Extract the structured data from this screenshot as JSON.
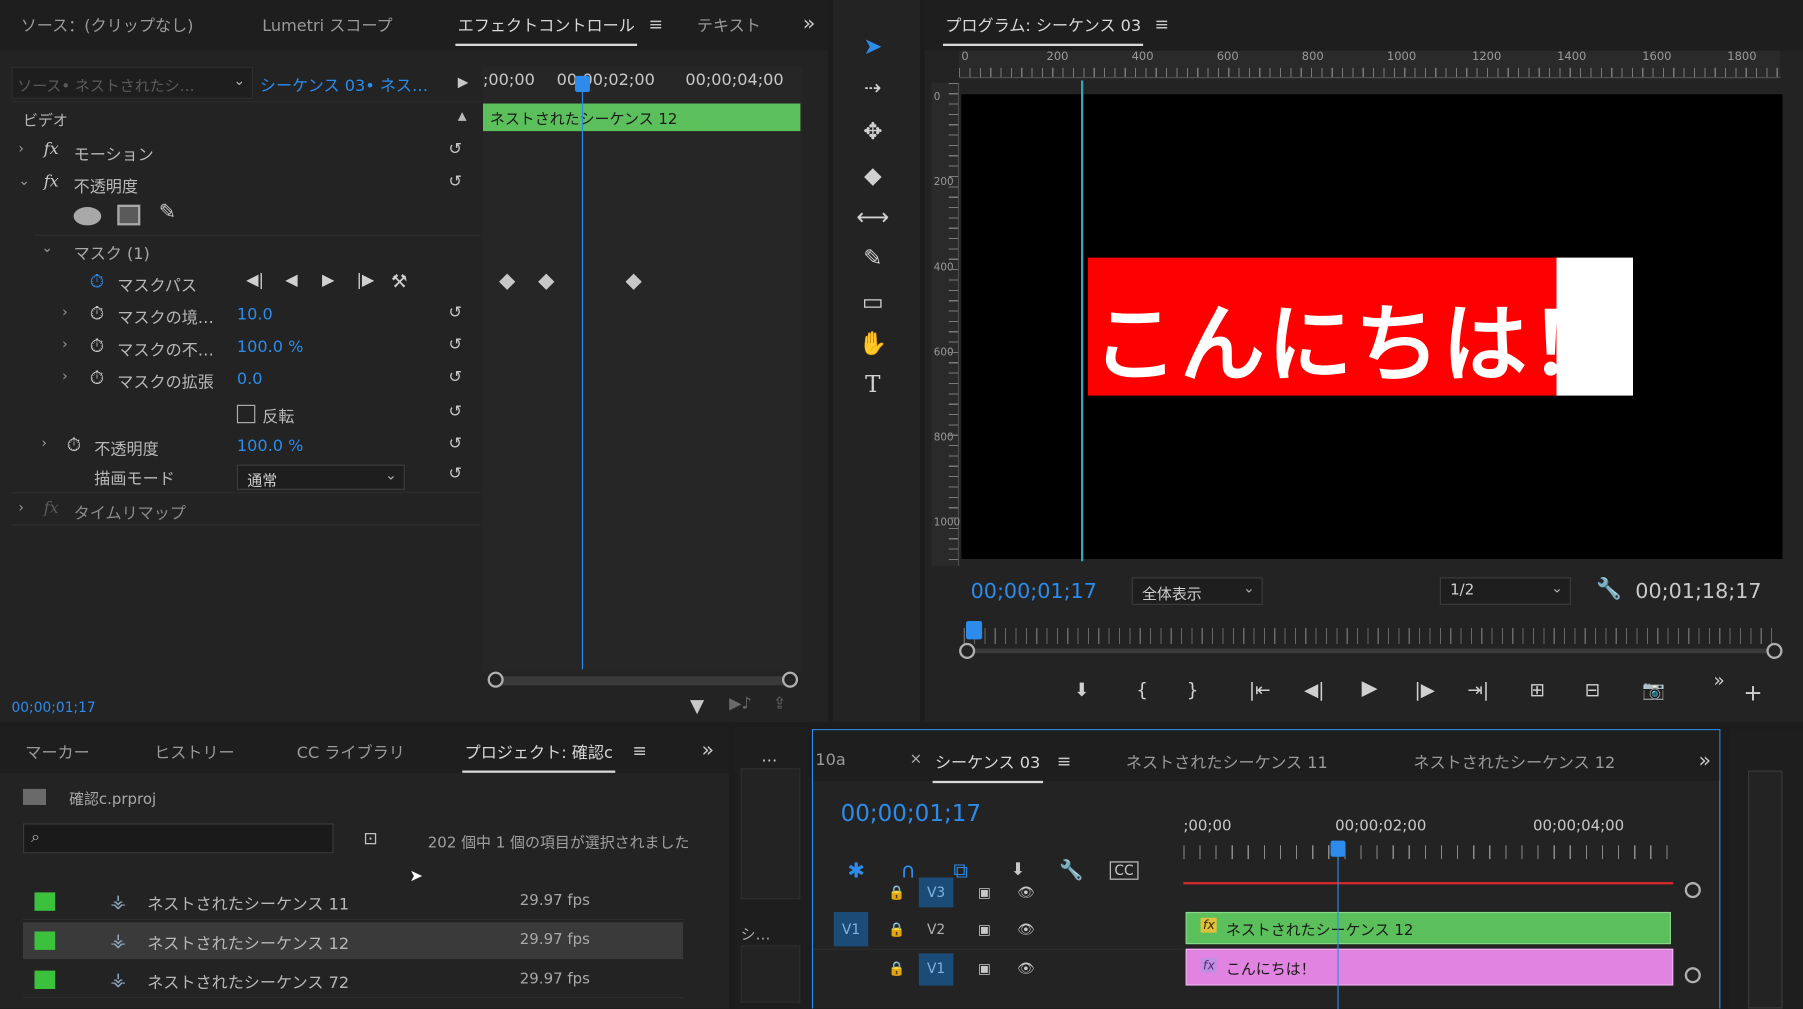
{
  "effect_panel": {
    "tabs": [
      "ソース：(クリップなし)",
      "Lumetri スコープ",
      "エフェクトコントロール",
      "テキスト"
    ],
    "source_label": "ソース• ネストされたシ…",
    "sequence_label": "シーケンス 03• ネス…",
    "ruler": [
      ";00;00",
      "00;00;02;00",
      "00;00;04;00"
    ],
    "clip_name": "ネストされたシーケンス 12",
    "video_label": "ビデオ",
    "motion_label": "モーション",
    "opacity_label": "不透明度",
    "mask_label": "マスク (1)",
    "mask_path_label": "マスクパス",
    "mask_feather_label": "マスクの境…",
    "mask_feather_value": "10.0",
    "mask_opacity_label": "マスクの不…",
    "mask_opacity_value": "100.0 %",
    "mask_expansion_label": "マスクの拡張",
    "mask_expansion_value": "0.0",
    "invert_label": "反転",
    "opacity_prop_label": "不透明度",
    "opacity_value": "100.0 %",
    "blend_mode_label": "描画モード",
    "blend_mode_value": "通常",
    "time_remap_label": "タイムリマップ",
    "timecode": "00;00;01;17"
  },
  "program": {
    "title": "プログラム: シーケンス 03",
    "ruler": [
      "0",
      "200",
      "400",
      "600",
      "800",
      "1000",
      "1200",
      "1400",
      "1600",
      "1800"
    ],
    "vruler": [
      "0",
      "200",
      "400",
      "600",
      "800",
      "1000"
    ],
    "text": "こんにちは！",
    "timecode": "00;00;01;17",
    "fit_value": "全体表示",
    "quality_value": "1/2",
    "duration": "00;01;18;17"
  },
  "project": {
    "tabs": [
      "マーカー",
      "ヒストリー",
      "CC ライブラリ",
      "プロジェクト: 確認c"
    ],
    "file_name": "確認c.prproj",
    "selection_info": "202 個中 1 個の項目が選択されました",
    "items": [
      {
        "name": "ネストされたシーケンス 11",
        "fps": "29.97 fps"
      },
      {
        "name": "ネストされたシーケンス 12",
        "fps": "29.97 fps"
      },
      {
        "name": "ネストされたシーケンス 72",
        "fps": "29.97 fps"
      }
    ],
    "mid_label": "シ…",
    "mid_dots": "…"
  },
  "timeline": {
    "partial_tab": "10a",
    "tabs": [
      "シーケンス 03",
      "ネストされたシーケンス 11",
      "ネストされたシーケンス 12"
    ],
    "timecode": "00;00;01;17",
    "ruler": [
      ";00;00",
      "00;00;02;00",
      "00;00;04;00"
    ],
    "tracks": [
      "V3",
      "V2",
      "V1"
    ],
    "source_track": "V1",
    "clip_v2": "ネストされたシーケンス 12",
    "clip_v1": "こんにちは！",
    "fx_badge": "fx"
  },
  "colors": {
    "accent": "#2d8ceb",
    "clip_green": "#5bbf5b",
    "clip_pink": "#e184e1",
    "title_red": "#ff0000"
  }
}
